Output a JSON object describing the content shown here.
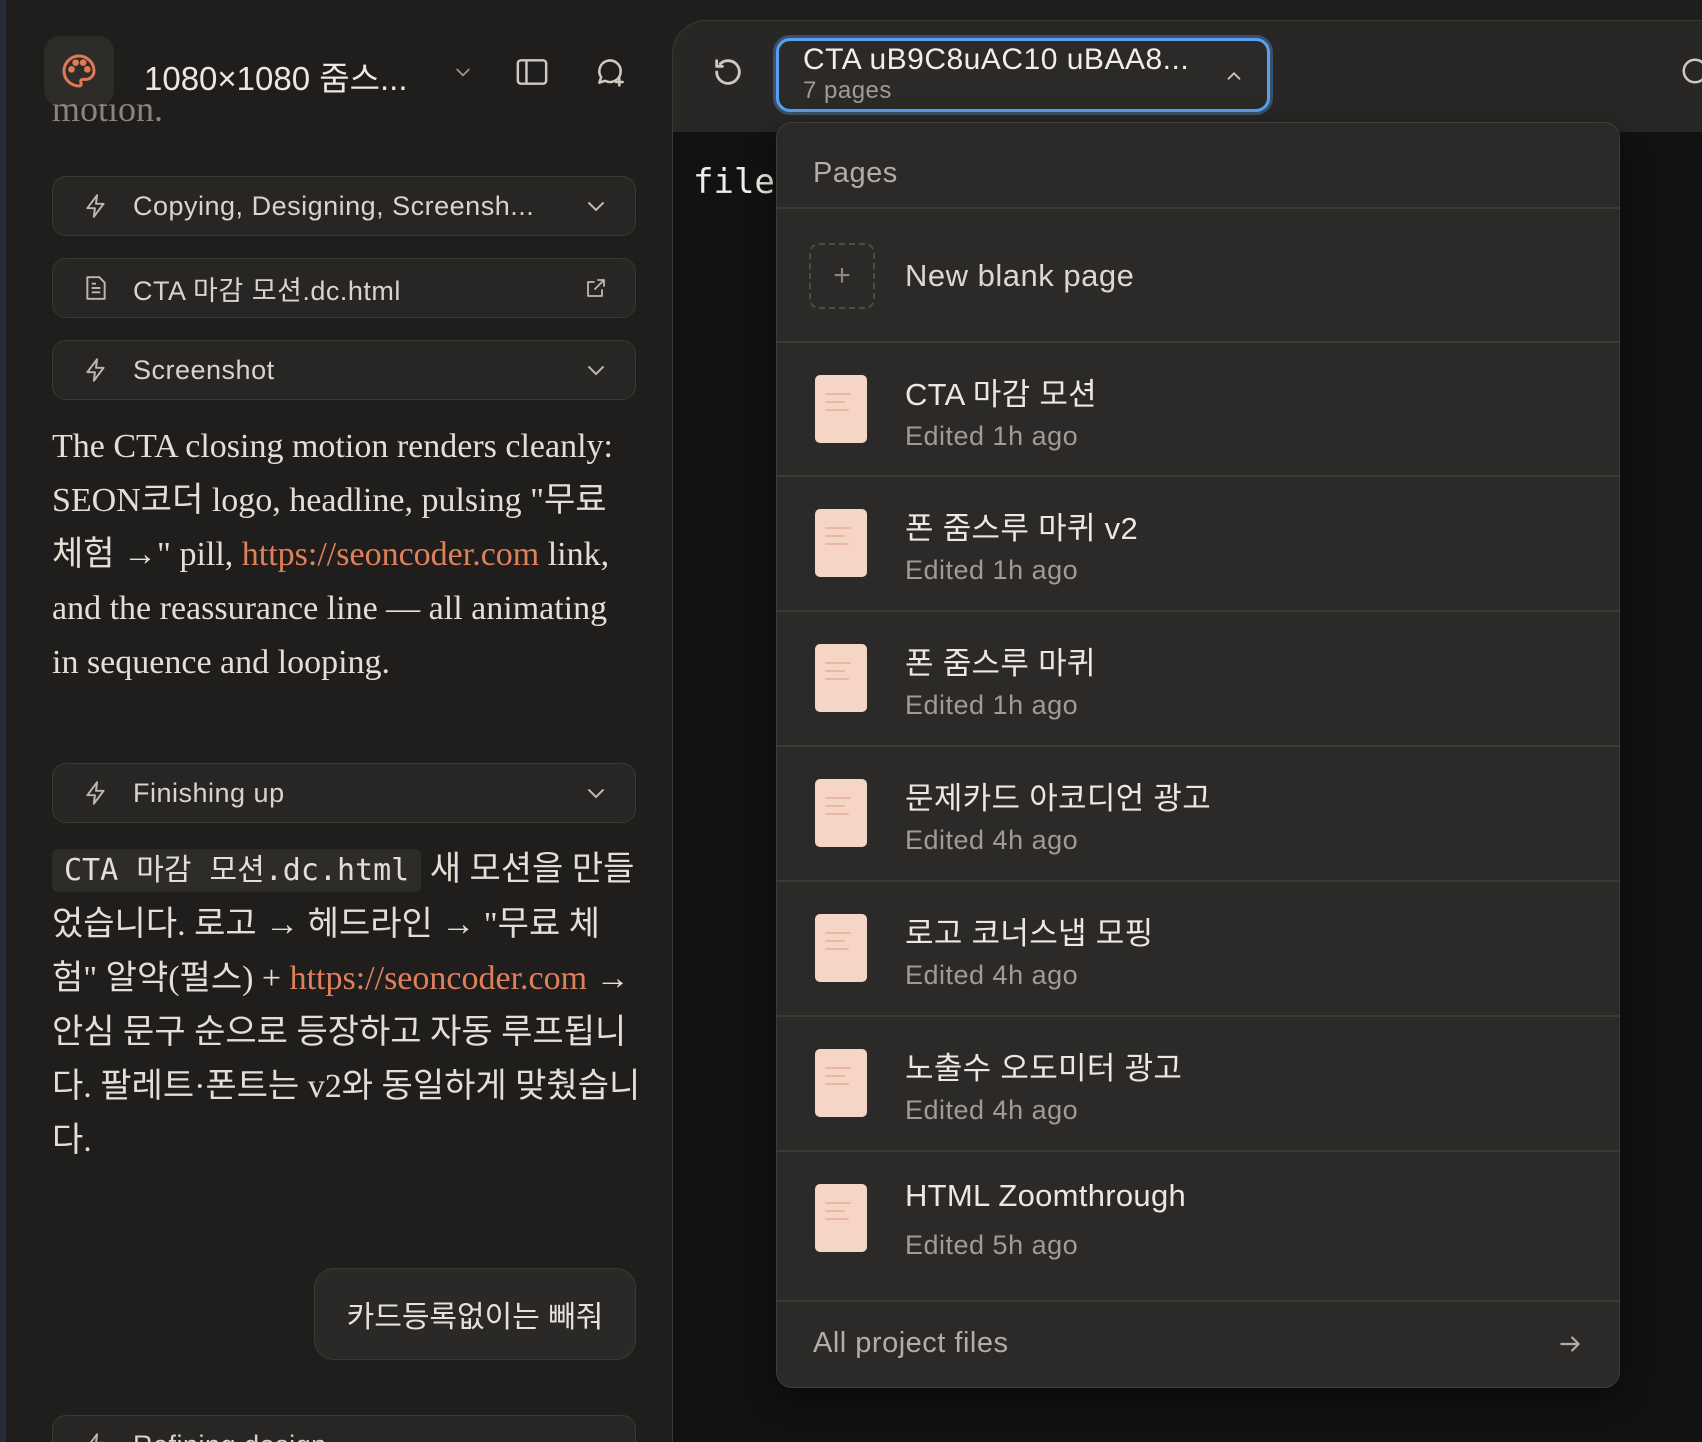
{
  "sidebar": {
    "project_title": "1080×1080 줌스...",
    "cut_text": "motion.",
    "tool_chips": [
      {
        "label": "Copying, Designing, Screensh...",
        "icon": "bolt-icon",
        "right_icon": "chevron-down-icon"
      },
      {
        "label": "CTA 마감 모션.dc.html",
        "icon": "document-icon",
        "right_icon": "external-link-icon"
      },
      {
        "label": "Screenshot",
        "icon": "bolt-icon",
        "right_icon": "chevron-down-icon"
      },
      {
        "label": "Finishing up",
        "icon": "bolt-icon",
        "right_icon": "chevron-down-icon"
      }
    ],
    "message1": {
      "text_a": "The CTA closing motion renders cleanly: SEON코더 logo, headline, pulsing \"무료 체험 →\" pill, ",
      "link": "https://seoncoder.com",
      "text_b": " link, and the reassurance line — all animating in sequence and looping."
    },
    "message2": {
      "code": "CTA 마감 모션.dc.html",
      "text_a": " 새 모션을 만들었습니다. 로고 → 헤드라인 → \"무료 체험\" 알약(펄스) + ",
      "link": "https://seoncoder.com",
      "text_b": " → 안심 문구 순으로 등장하고 자동 루프됩니다. 팔레트·폰트는 v2와 동일하게 맞췄습니다."
    },
    "user_message": "카드등록없이는 빼줘",
    "bottom_chip_label": "Refining design"
  },
  "toolbar": {
    "selected_page_title": "CTA uB9C8uAC10 uBAA8...",
    "page_count": "7 pages"
  },
  "canvas": {
    "code_text": "file"
  },
  "pages_dropdown": {
    "header": "Pages",
    "new_page_label": "New blank page",
    "items": [
      {
        "title": "CTA 마감 모션",
        "edited": "Edited 1h ago"
      },
      {
        "title": "폰 줌스루 마퀴 v2",
        "edited": "Edited 1h ago"
      },
      {
        "title": "폰 줌스루 마퀴",
        "edited": "Edited 1h ago"
      },
      {
        "title": "문제카드 아코디언 광고",
        "edited": "Edited 4h ago"
      },
      {
        "title": "로고 코너스냅 모핑",
        "edited": "Edited 4h ago"
      },
      {
        "title": "노출수 오도미터 광고",
        "edited": "Edited 4h ago"
      },
      {
        "title": "HTML Zoomthrough",
        "edited": "Edited 5h ago"
      }
    ],
    "footer_label": "All project files"
  },
  "colors": {
    "accent_link": "#e0805a",
    "selector_focus": "#5aa0ee",
    "thumbnail": "#f7d5c6",
    "app_icon": "#e07a55"
  }
}
